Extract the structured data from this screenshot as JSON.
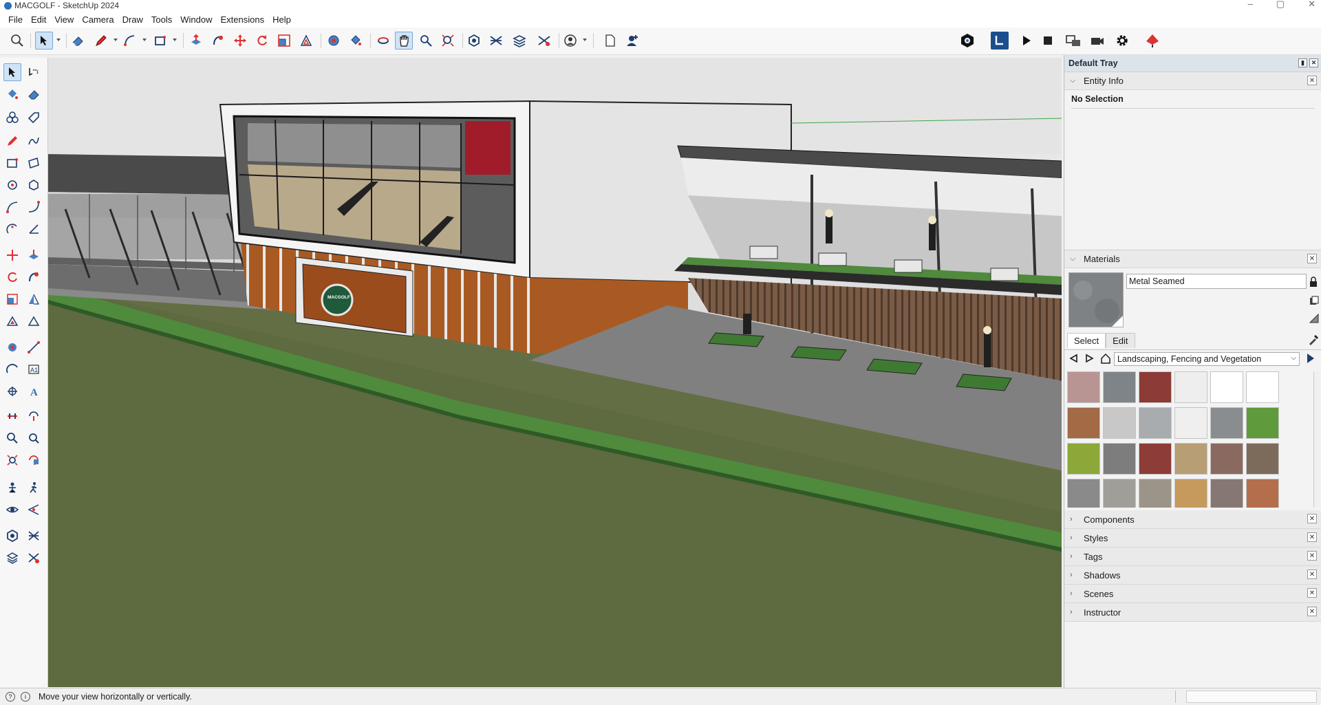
{
  "window": {
    "title": "MACGOLF - SketchUp 2024"
  },
  "menu": [
    "File",
    "Edit",
    "View",
    "Camera",
    "Draw",
    "Tools",
    "Window",
    "Extensions",
    "Help"
  ],
  "tray": {
    "title": "Default Tray",
    "entity_info": {
      "label": "Entity Info",
      "selection_text": "No Selection"
    },
    "materials": {
      "label": "Materials",
      "material_name": "Metal Seamed",
      "tabs": [
        "Select",
        "Edit"
      ],
      "active_tab": "Select",
      "collection": "Landscaping, Fencing and Vegetation",
      "swatch_colors": [
        [
          "#b89593",
          "#7f8488",
          "#8c3b36",
          "#eeeeee",
          "#ffffff",
          "#ffffff"
        ],
        [
          "#a36a46",
          "#c8c8c8",
          "#a9acae",
          "#efefef",
          "#8a8d90",
          "#5f9a3c"
        ],
        [
          "#8ba838",
          "#7d7d7d",
          "#8e3c38",
          "#b89e74",
          "#8a6a60",
          "#7c6b5b"
        ],
        [
          "#8a8a8a",
          "#a09e99",
          "#9b9488",
          "#c69a5d",
          "#877773",
          "#b56e4c"
        ]
      ]
    },
    "collapsed_panels": [
      "Components",
      "Styles",
      "Tags",
      "Shadows",
      "Scenes",
      "Instructor"
    ]
  },
  "status": {
    "hint": "Move your view horizontally or vertically."
  },
  "icons": {
    "toolbar": [
      "magnify-icon",
      "select-icon",
      "eraser-icon",
      "pencil-icon",
      "line-icon",
      "rectangle-icon",
      "push-pull-icon",
      "follow-me-icon",
      "move-icon",
      "rotate-icon",
      "scale-icon",
      "offset-icon",
      "orbit-icon",
      "pan-icon",
      "zoom-icon",
      "zoom-extents-icon",
      "section-icon",
      "walk-icon",
      "layers-icon",
      "person-icon",
      "page-icon",
      "user-icon"
    ]
  },
  "scene": {
    "sign_text": "MACGOLF"
  }
}
